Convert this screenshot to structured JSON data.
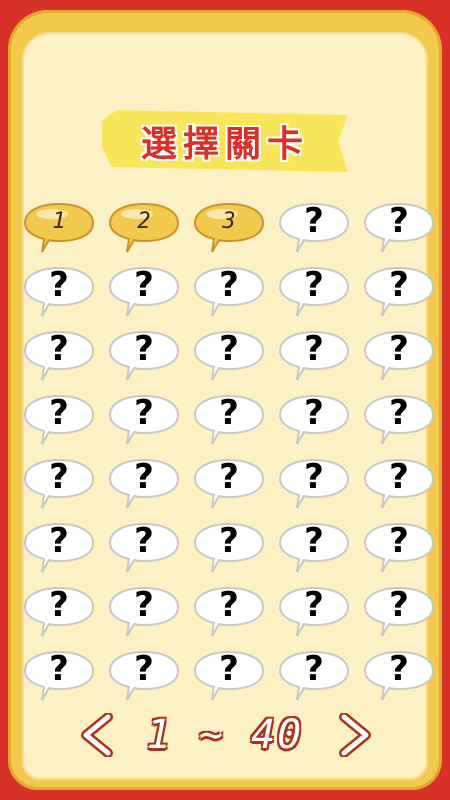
{
  "title": "選擇關卡",
  "levels": [
    {
      "label": "1",
      "unlocked": true
    },
    {
      "label": "2",
      "unlocked": true
    },
    {
      "label": "3",
      "unlocked": true
    },
    {
      "label": "?",
      "unlocked": false
    },
    {
      "label": "?",
      "unlocked": false
    },
    {
      "label": "?",
      "unlocked": false
    },
    {
      "label": "?",
      "unlocked": false
    },
    {
      "label": "?",
      "unlocked": false
    },
    {
      "label": "?",
      "unlocked": false
    },
    {
      "label": "?",
      "unlocked": false
    },
    {
      "label": "?",
      "unlocked": false
    },
    {
      "label": "?",
      "unlocked": false
    },
    {
      "label": "?",
      "unlocked": false
    },
    {
      "label": "?",
      "unlocked": false
    },
    {
      "label": "?",
      "unlocked": false
    },
    {
      "label": "?",
      "unlocked": false
    },
    {
      "label": "?",
      "unlocked": false
    },
    {
      "label": "?",
      "unlocked": false
    },
    {
      "label": "?",
      "unlocked": false
    },
    {
      "label": "?",
      "unlocked": false
    },
    {
      "label": "?",
      "unlocked": false
    },
    {
      "label": "?",
      "unlocked": false
    },
    {
      "label": "?",
      "unlocked": false
    },
    {
      "label": "?",
      "unlocked": false
    },
    {
      "label": "?",
      "unlocked": false
    },
    {
      "label": "?",
      "unlocked": false
    },
    {
      "label": "?",
      "unlocked": false
    },
    {
      "label": "?",
      "unlocked": false
    },
    {
      "label": "?",
      "unlocked": false
    },
    {
      "label": "?",
      "unlocked": false
    },
    {
      "label": "?",
      "unlocked": false
    },
    {
      "label": "?",
      "unlocked": false
    },
    {
      "label": "?",
      "unlocked": false
    },
    {
      "label": "?",
      "unlocked": false
    },
    {
      "label": "?",
      "unlocked": false
    },
    {
      "label": "?",
      "unlocked": false
    },
    {
      "label": "?",
      "unlocked": false
    },
    {
      "label": "?",
      "unlocked": false
    },
    {
      "label": "?",
      "unlocked": false
    },
    {
      "label": "?",
      "unlocked": false
    }
  ],
  "pager": {
    "prev_icon": "chevron-left-icon",
    "range": "1 ~ 40",
    "next_icon": "chevron-right-icon"
  },
  "colors": {
    "background_red": "#d8312a",
    "frame_gold": "#f2c94c",
    "panel_cream": "#fcf1c4",
    "unlocked_bubble": "#f2c94c",
    "locked_bubble": "#ffffff"
  }
}
